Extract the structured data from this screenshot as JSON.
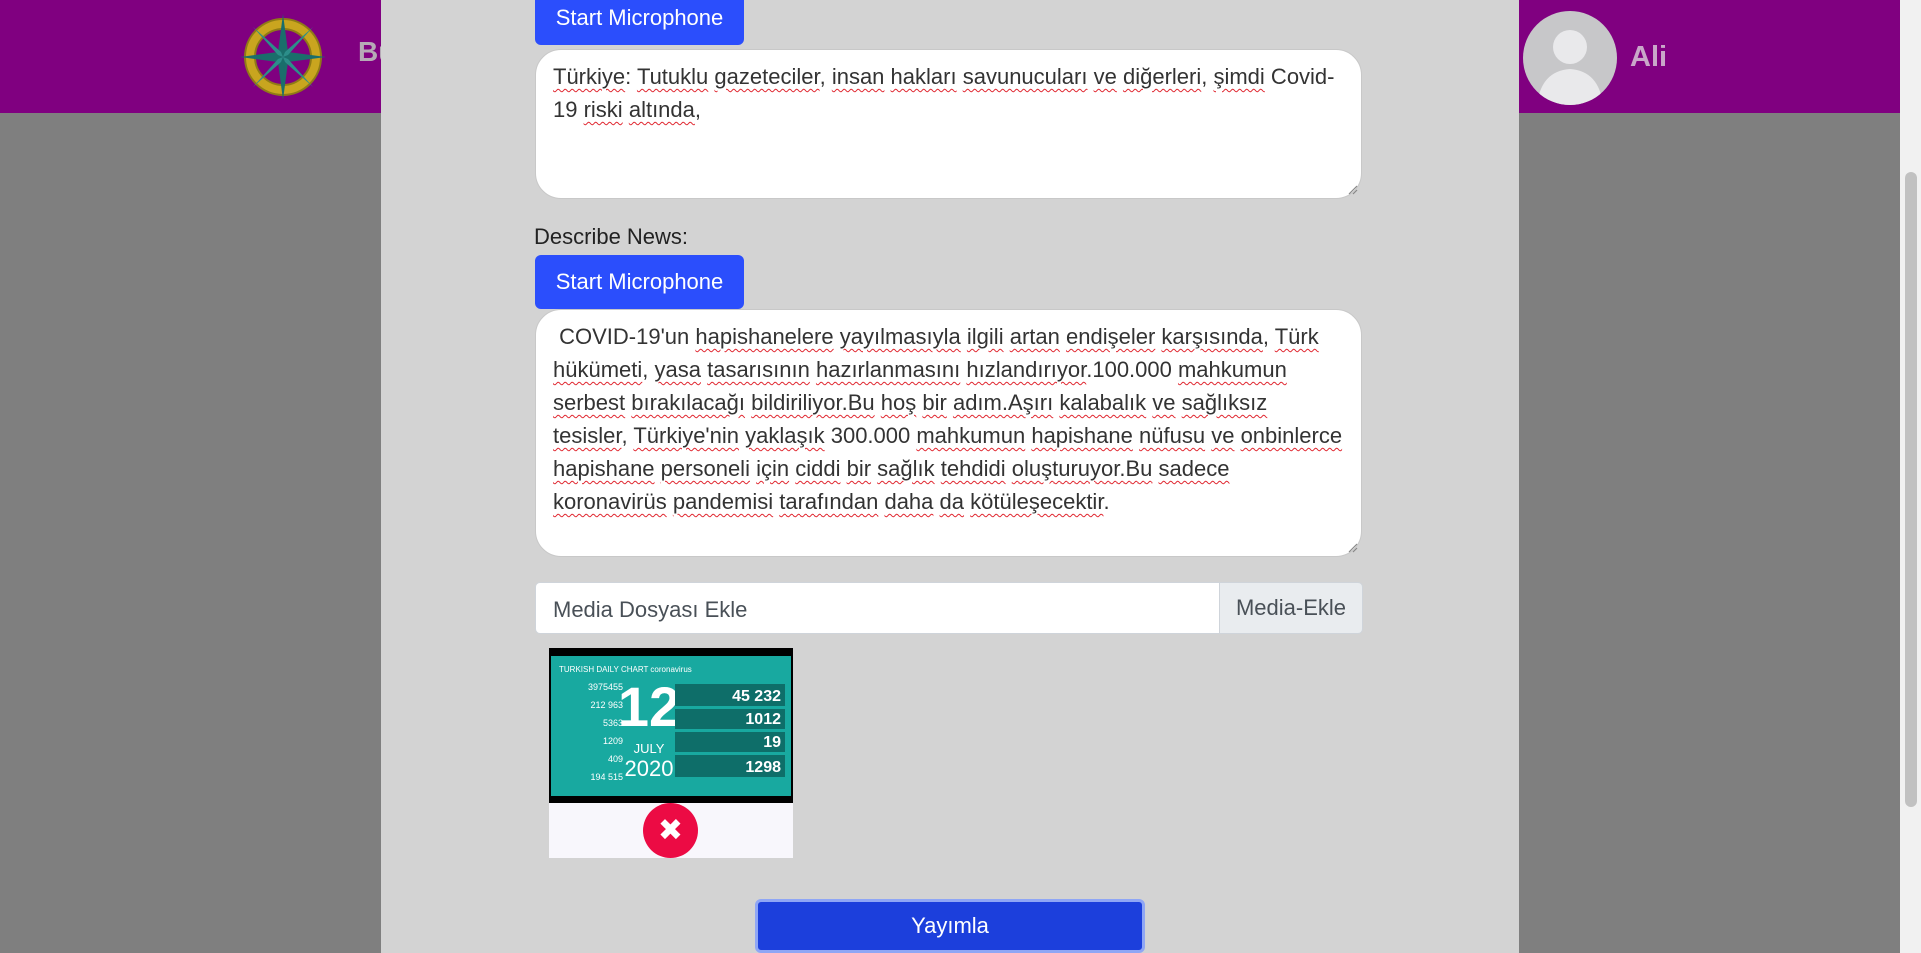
{
  "header": {
    "brand_text": "Bü",
    "username": "Ali"
  },
  "form": {
    "mic_button_label": "Start Microphone",
    "title_textarea_words": [
      "Türkiye",
      ":",
      "Tutuklu",
      "gazeteciler,",
      "insan",
      "hakları",
      "savunucuları",
      "ve",
      "diğerleri,",
      "şimdi",
      "Covid-19",
      "riski",
      "altında,"
    ],
    "title_text": "Türkiye: Tutuklu gazeteciler, insan hakları savunucuları ve diğerleri, şimdi Covid-19 riski altında,",
    "describe_label": "Describe News:",
    "description_text": " COVID-19'un hapishanelere yayılmasıyla ilgili artan endişeler karşısında, Türk hükümeti, yasa tasarısının hazırlanmasını hızlandırıyor.100.000 mahkumun serbest bırakılacağı bildiriliyor.Bu hoş bir adım.Aşırı kalabalık ve sağlıksız tesisler, Türkiye'nin yaklaşık 300.000 mahkumun hapishane nüfusu ve onbinlerce hapishane personeli için ciddi bir sağlık tehdidi oluşturuyor.Bu sadece koronavirüs pandemisi tarafından daha da kötüleşecektir.",
    "file_placeholder": "Media Dosyası Ekle",
    "file_button_label": "Media-Ekle",
    "publish_label": "Yayımla"
  },
  "media": {
    "thumb_title": "TURKISH DAILY CHART coronavirus",
    "left_numbers": [
      "3975455",
      "212 963",
      "5363",
      "1209",
      "409",
      "194 515"
    ],
    "day": "12",
    "month": "JULY",
    "year": "2020",
    "right_numbers": [
      "45 232",
      "1012",
      "19",
      "1298"
    ],
    "remove_icon": "close-icon"
  },
  "colors": {
    "header_bg": "#800080",
    "modal_bg": "#d3d3d3",
    "primary_button": "#2b4efc",
    "publish_button": "#1c3fdc",
    "remove_button": "#ec0b44",
    "thumb_bg": "#18a9a0"
  }
}
